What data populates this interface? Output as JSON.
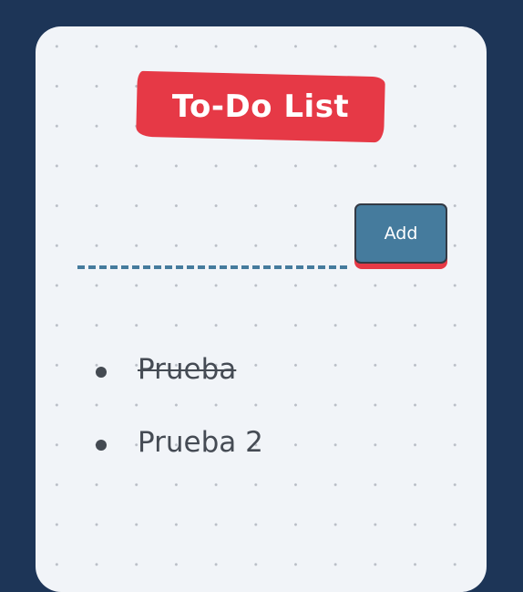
{
  "app": {
    "title": "To-Do List"
  },
  "form": {
    "input_value": "",
    "input_placeholder": "",
    "add_label": "Add"
  },
  "tasks": [
    {
      "text": "Prueba",
      "done": true
    },
    {
      "text": "Prueba 2",
      "done": false
    }
  ],
  "colors": {
    "page_background": "#1d3557",
    "card_background": "#f1f4f8",
    "accent_red": "#e63946",
    "accent_blue": "#457b9d",
    "text_dark": "#454b54"
  }
}
